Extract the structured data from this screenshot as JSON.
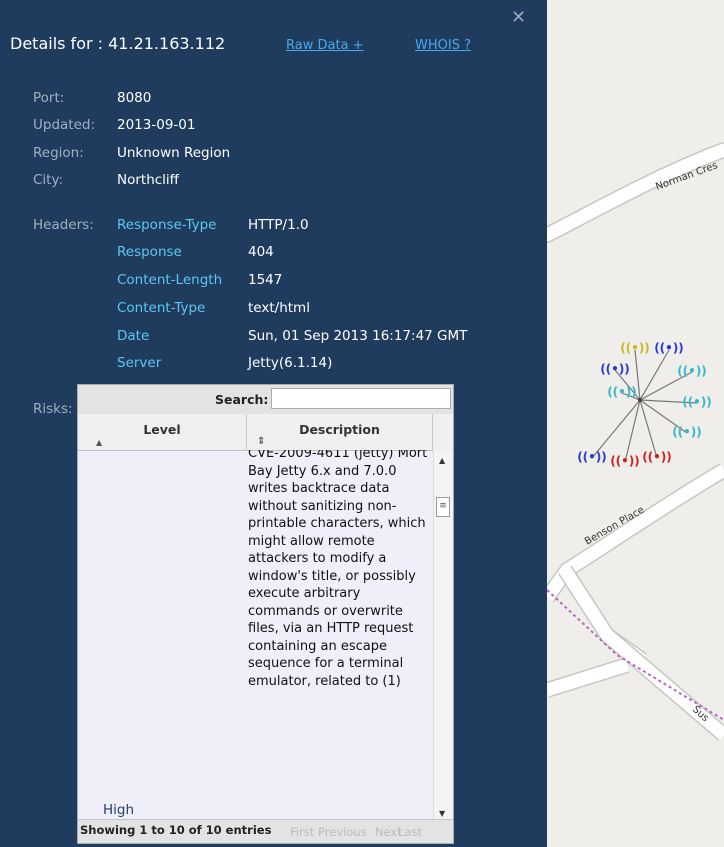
{
  "title": "Details for : 41.21.163.112",
  "links": {
    "raw_data": "Raw Data +",
    "whois": "WHOIS ?"
  },
  "close": "✕",
  "info": [
    {
      "label": "Port:",
      "value": "8080"
    },
    {
      "label": "Updated:",
      "value": "2013-09-01"
    },
    {
      "label": "Region:",
      "value": "Unknown Region"
    },
    {
      "label": "City:",
      "value": "Northcliff"
    }
  ],
  "headers_label": "Headers:",
  "headers": [
    {
      "key": "Response-Type",
      "value": "HTTP/1.0"
    },
    {
      "key": "Response",
      "value": "404"
    },
    {
      "key": "Content-Length",
      "value": "1547"
    },
    {
      "key": "Content-Type",
      "value": "text/html"
    },
    {
      "key": "Date",
      "value": "Sun, 01 Sep 2013 16:17:47 GMT"
    },
    {
      "key": "Server",
      "value": "Jetty(6.1.14)"
    }
  ],
  "risks": {
    "label": "Risks:",
    "search_label": "Search:",
    "columns": [
      "Level",
      "Description"
    ],
    "rows": [
      {
        "level": "High",
        "description": "CVE-2009-4611 (jetty) Mort Bay Jetty 6.x and 7.0.0 writes backtrace data without sanitizing non-printable characters, which might allow remote attackers to modify a window's title, or possibly execute arbitrary commands or overwrite files, via an HTTP request containing an escape sequence for a terminal emulator, related to (1)"
      }
    ],
    "info": "Showing 1 to 10 of 10 entries",
    "pagination": [
      "First",
      "Previous",
      "Next",
      "Last"
    ]
  },
  "map": {
    "streets": [
      "Norman Cres",
      "Benson Place",
      "Sus"
    ]
  },
  "colors": {
    "panel": "#1f3c5f",
    "link": "#4aa8e8",
    "header_key": "#5ec7ee"
  }
}
